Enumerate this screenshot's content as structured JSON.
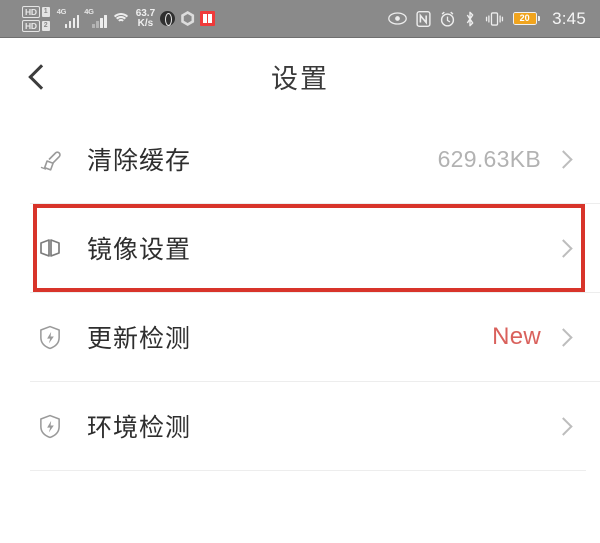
{
  "status_bar": {
    "hd_badges": [
      "HD",
      "HD"
    ],
    "sim_labels": [
      "1",
      "2"
    ],
    "network_labels": [
      "4G",
      "4G"
    ],
    "wifi_icon": "wifi-icon",
    "network_speed": "63.7",
    "network_speed_unit": "K/s",
    "app_icons": [
      "globe-app-icon",
      "hexagon-app-icon",
      "book-app-icon"
    ],
    "right_icons": [
      "eye-icon",
      "nfc-icon",
      "alarm-clock-icon",
      "bluetooth-icon",
      "vibrate-icon"
    ],
    "battery_level": "20",
    "time": "3:45"
  },
  "nav": {
    "back_icon": "chevron-left-icon",
    "title": "设置"
  },
  "list": {
    "rows": [
      {
        "icon": "brush-icon",
        "label": "清除缓存",
        "value": "629.63KB",
        "badge": "",
        "chevron": "chevron-right-icon",
        "highlighted": false
      },
      {
        "icon": "mirror-icon",
        "label": "镜像设置",
        "value": "",
        "badge": "",
        "chevron": "chevron-right-icon",
        "highlighted": true
      },
      {
        "icon": "shield-bolt-icon",
        "label": "更新检测",
        "value": "",
        "badge": "New",
        "chevron": "chevron-right-icon",
        "highlighted": false
      },
      {
        "icon": "shield-bolt-icon",
        "label": "环境检测",
        "value": "",
        "badge": "",
        "chevron": "chevron-right-icon",
        "highlighted": false
      }
    ]
  },
  "colors": {
    "status_bar_bg": "#8a8a8a",
    "highlight_red": "#d8342a",
    "badge_red": "#d9615c",
    "battery_orange": "#f0a41e",
    "label_dark": "#2e2e2e",
    "value_gray": "#b2b2b2"
  }
}
